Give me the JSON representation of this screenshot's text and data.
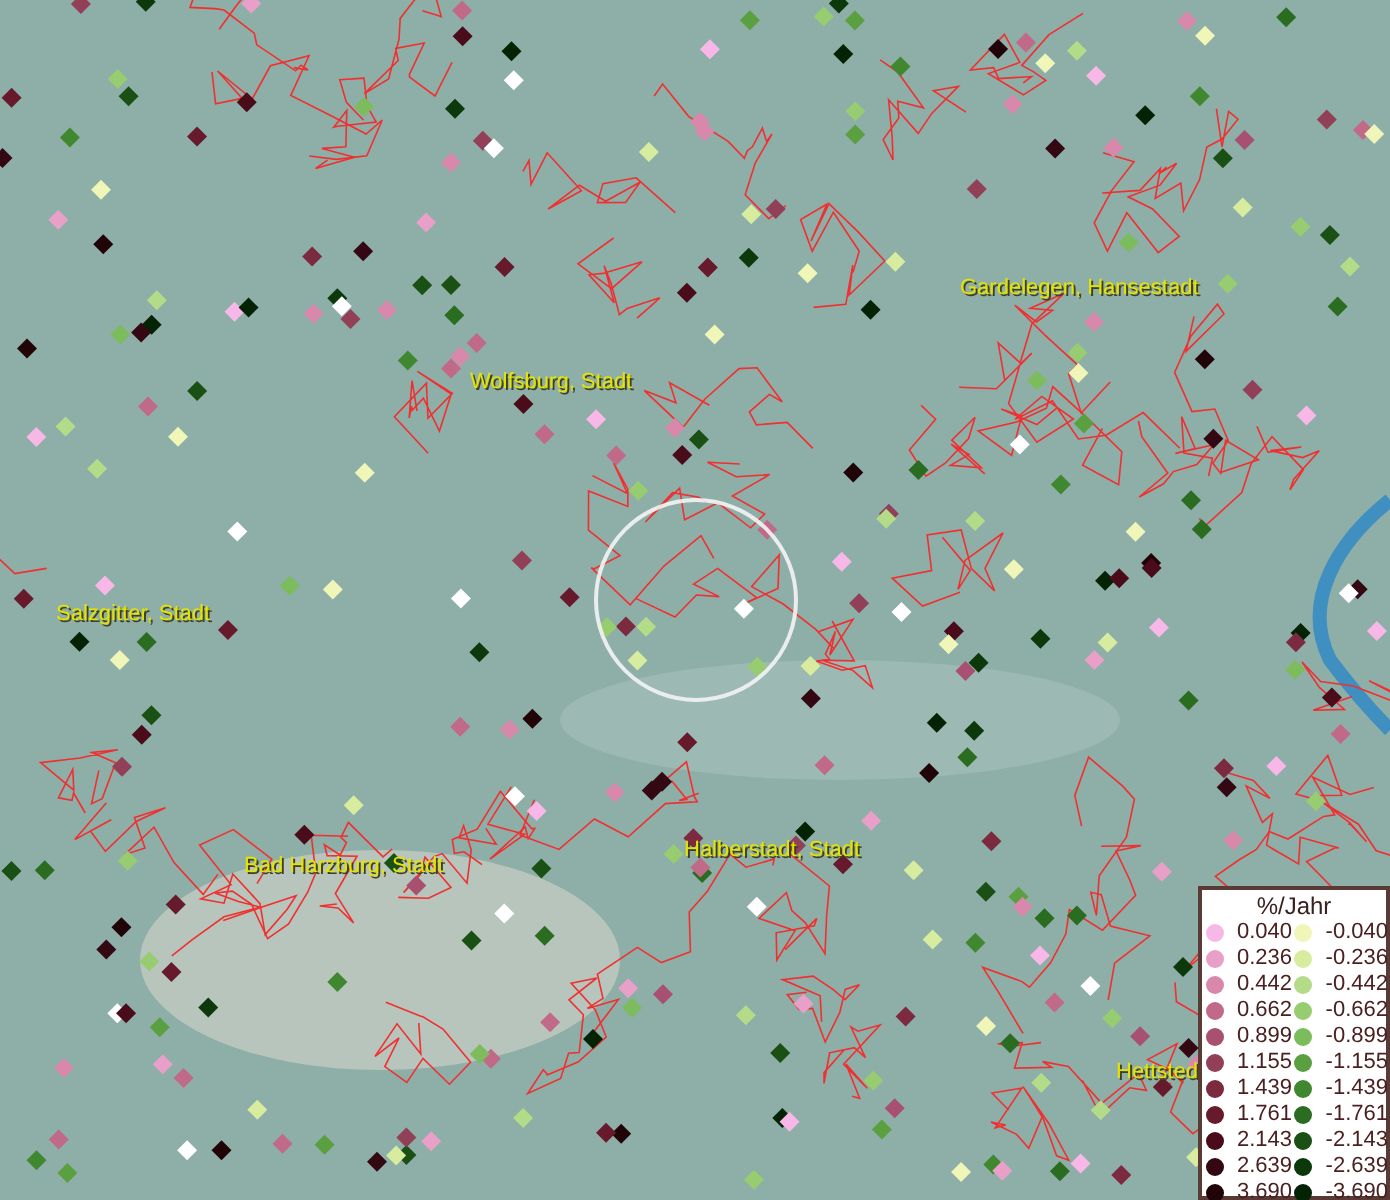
{
  "map": {
    "places": [
      {
        "name": "Gardelegen, Hansestadt"
      },
      {
        "name": "Wolfsburg, Stadt"
      },
      {
        "name": "Salzgitter, Stadt"
      },
      {
        "name": "Bad Harzburg, Stadt"
      },
      {
        "name": "Halberstadt, Stadt"
      },
      {
        "name": "Hettsted"
      }
    ]
  },
  "legend": {
    "title": "%/Jahr",
    "positive": [
      {
        "label": "0.040",
        "color": "#f7b8e8"
      },
      {
        "label": "0.236",
        "color": "#e8a0c8"
      },
      {
        "label": "0.442",
        "color": "#d888aa"
      },
      {
        "label": "0.662",
        "color": "#c06a88"
      },
      {
        "label": "0.899",
        "color": "#a85070"
      },
      {
        "label": "1.155",
        "color": "#923f58"
      },
      {
        "label": "1.439",
        "color": "#7c2a40"
      },
      {
        "label": "1.761",
        "color": "#661a2c"
      },
      {
        "label": "2.143",
        "color": "#4a0c1a"
      },
      {
        "label": "2.639",
        "color": "#330812"
      },
      {
        "label": "3.690",
        "color": "#200408"
      }
    ],
    "negative": [
      {
        "label": "-0.040",
        "color": "#f0f5b8"
      },
      {
        "label": "-0.236",
        "color": "#d8eca0"
      },
      {
        "label": "-0.442",
        "color": "#b4dc88"
      },
      {
        "label": "-0.662",
        "color": "#98cc70"
      },
      {
        "label": "-0.899",
        "color": "#7cbc5c"
      },
      {
        "label": "-1.155",
        "color": "#5aa040"
      },
      {
        "label": "-1.439",
        "color": "#408830"
      },
      {
        "label": "-1.761",
        "color": "#2a6c20"
      },
      {
        "label": "-2.143",
        "color": "#1a5014"
      },
      {
        "label": "-2.639",
        "color": "#0c380c"
      },
      {
        "label": "-3.690",
        "color": "#042204"
      }
    ]
  }
}
